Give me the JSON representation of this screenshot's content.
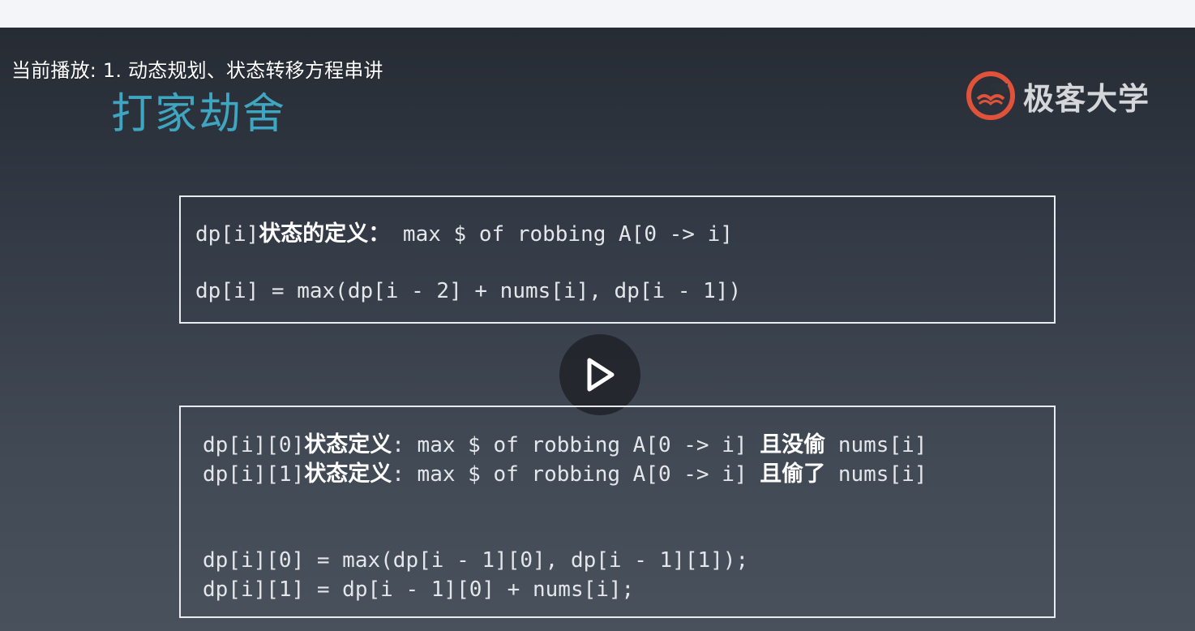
{
  "player": {
    "now_playing": "当前播放: 1. 动态规划、状态转移方程串讲"
  },
  "slide": {
    "title": "打家劫舍",
    "brand": "极客大学",
    "box1": {
      "line1_code_a": "dp[i]",
      "line1_zh": "状态的定义：",
      "line1_code_b": " max $ of robbing A[0 -> i]",
      "line2": "dp[i] = max(dp[i - 2] + nums[i], dp[i - 1])"
    },
    "box2": {
      "line1_code_a": "dp[i][0]",
      "line1_zh_a": "状态定义",
      "line1_code_b": ": max $ of robbing A[0 -> i] ",
      "line1_zh_b": "且没偷",
      "line1_code_c": " nums[i]",
      "line2_code_a": "dp[i][1]",
      "line2_zh_a": "状态定义",
      "line2_code_b": ": max $ of robbing A[0 -> i] ",
      "line2_zh_b": "且偷了",
      "line2_code_c": " nums[i]",
      "line3": "dp[i][0] = max(dp[i - 1][0], dp[i - 1][1]);",
      "line4": "dp[i][1] = dp[i - 1][0] + nums[i];"
    }
  },
  "icons": {
    "play": "play-icon",
    "logo": "geek-university-logo-icon"
  },
  "colors": {
    "title": "#3ea6c0",
    "logo_accent": "#e0523a",
    "box_border": "#e9ecef"
  }
}
